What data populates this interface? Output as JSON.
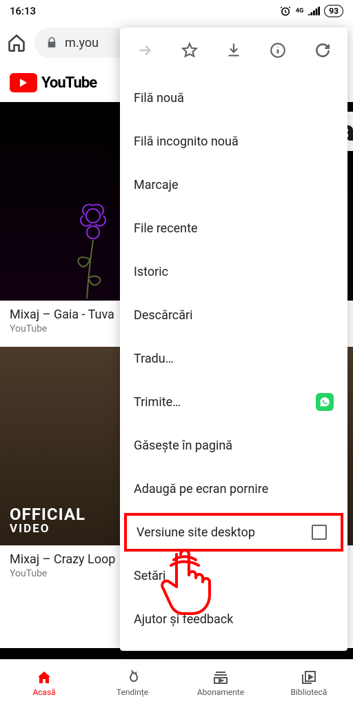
{
  "status": {
    "time": "16:13",
    "network": "4G",
    "battery": "93"
  },
  "url_bar": {
    "domain": "m.you"
  },
  "yt": {
    "brand": "YouTube"
  },
  "videos": [
    {
      "title": "Mixaj – Gaia - Tuva",
      "channel": "YouTube",
      "badge_line1": "",
      "badge_line2": ""
    },
    {
      "title": "Mixaj – Crazy Loop",
      "channel": "YouTube",
      "badge_line1": "OFFICIAL",
      "badge_line2": "VIDEO"
    }
  ],
  "menu": {
    "items": [
      "Filă nouă",
      "Filă incognito nouă",
      "Marcaje",
      "File recente",
      "Istoric",
      "Descărcări",
      "Tradu…",
      "Trimite…",
      "Găsește în pagină",
      "Adaugă pe ecran pornire",
      "Versiune site desktop",
      "Setări",
      "Ajutor și feedback"
    ]
  },
  "bottom_nav": {
    "home": "Acasă",
    "trending": "Tendințe",
    "subs": "Abonamente",
    "library": "Bibliotecă"
  }
}
